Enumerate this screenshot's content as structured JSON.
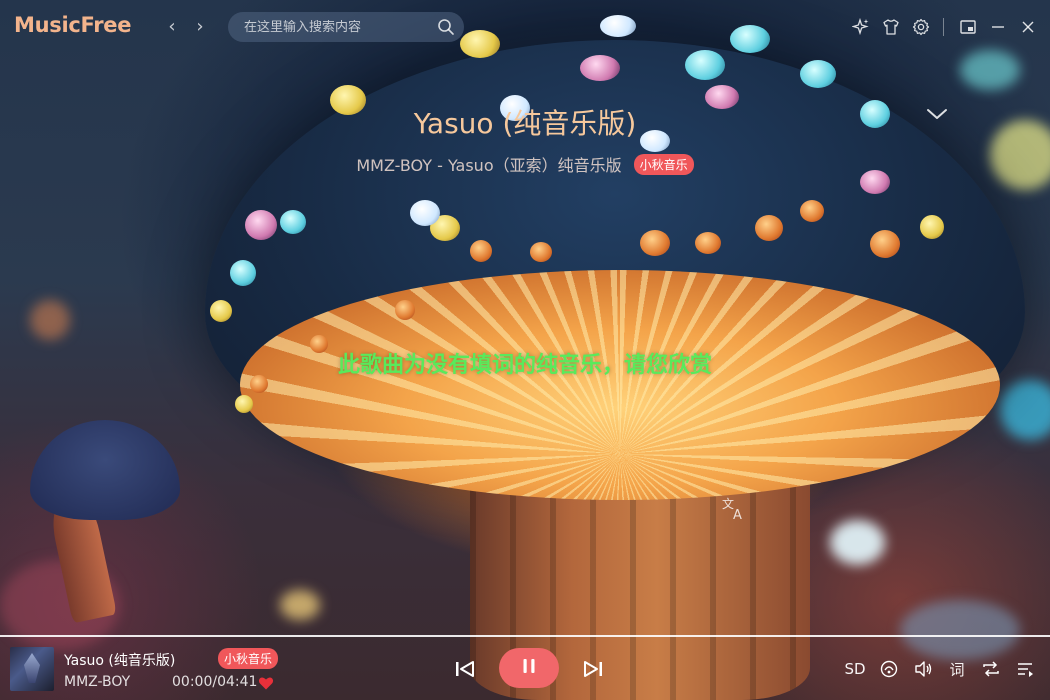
{
  "app": {
    "logo": "MusicFree"
  },
  "nav": {
    "back_icon": "‹",
    "forward_icon": "›"
  },
  "search": {
    "placeholder": "在这里输入搜索内容"
  },
  "song": {
    "title": "Yasuo (纯音乐版)",
    "subtitle": "MMZ-BOY - Yasuo（亚索）纯音乐版",
    "source_badge": "小秋音乐"
  },
  "lyrics": {
    "current": "此歌曲为没有填词的纯音乐，请您欣赏"
  },
  "player": {
    "title": "Yasuo (纯音乐版)",
    "source_badge": "小秋音乐",
    "artist": "MMZ-BOY",
    "time": "00:00/04:41",
    "quality": "SD",
    "lyric_toggle": "词",
    "progress": 0
  },
  "colors": {
    "logo": "#f3b48c",
    "title": "#f6c89c",
    "badge": "#f0575a",
    "lyric": "#59ea5b",
    "play_button": "#f1676a",
    "heart": "#e8303a"
  }
}
